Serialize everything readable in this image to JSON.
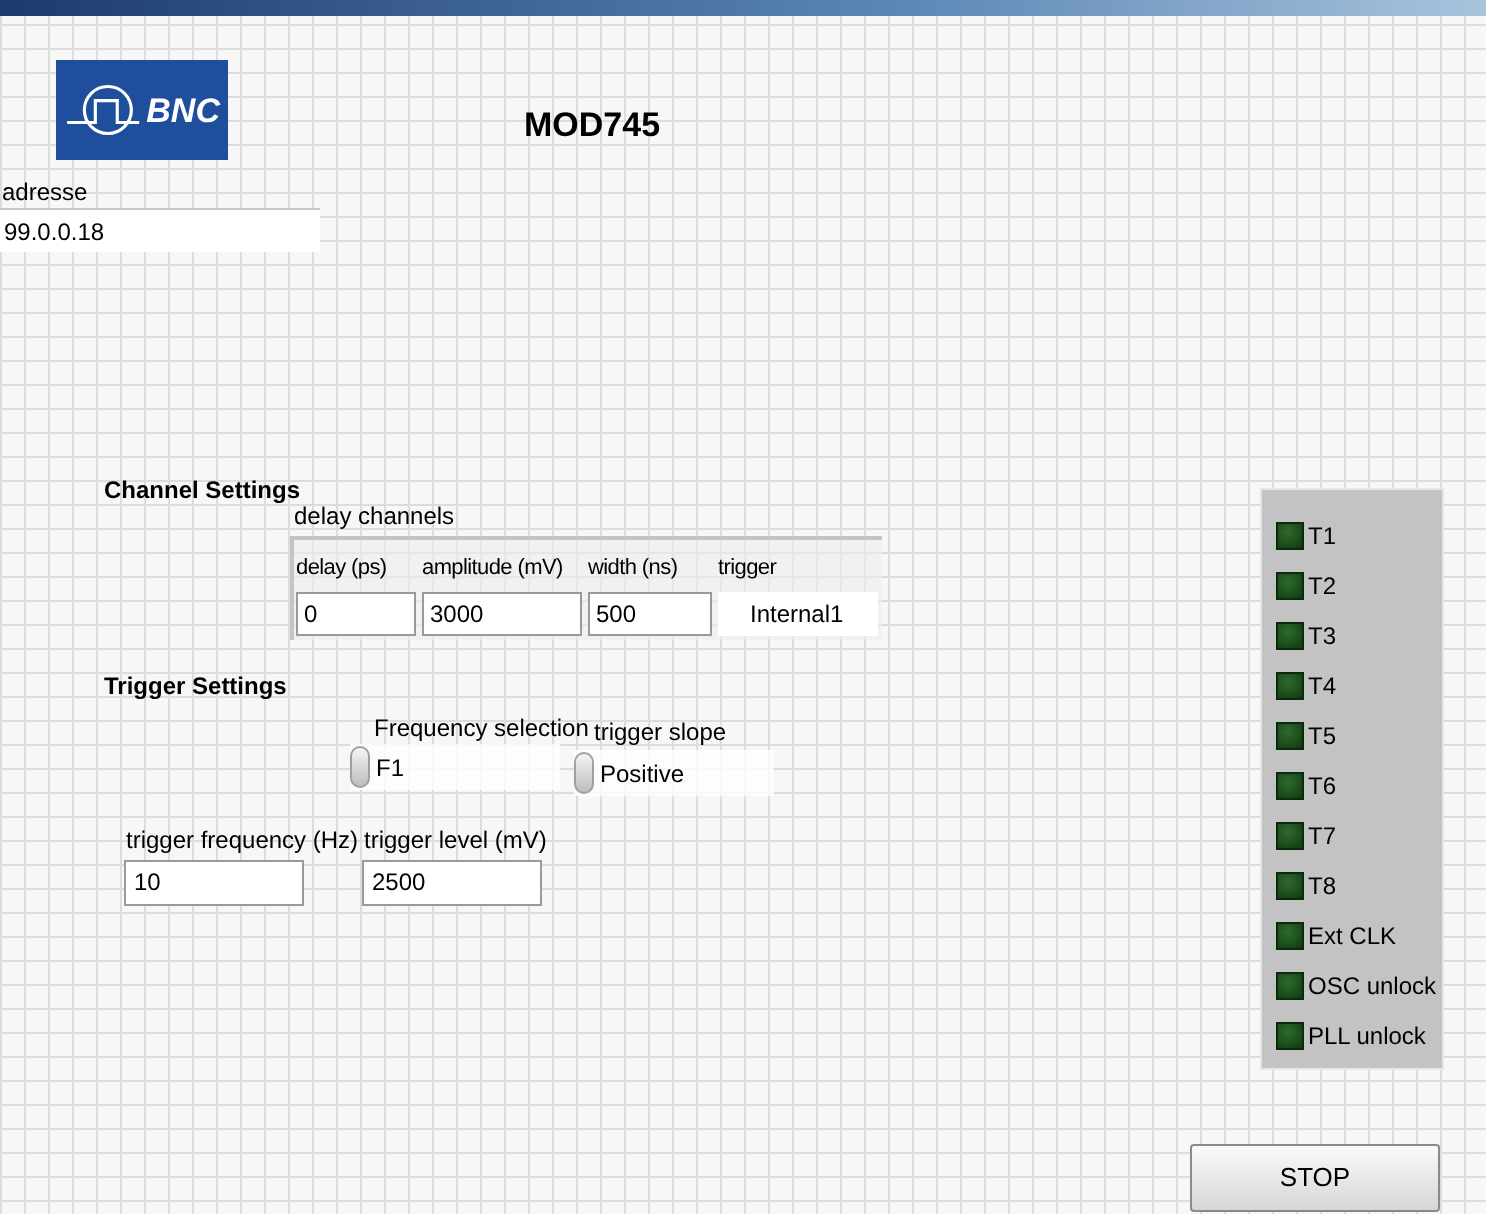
{
  "logo": {
    "text": "BNC"
  },
  "title": "MOD745",
  "address": {
    "label": "adresse",
    "value": "99.0.0.18"
  },
  "channel_settings": {
    "label": "Channel Settings",
    "table": {
      "label": "delay channels",
      "columns": [
        {
          "label": "delay (ps)",
          "value": "0",
          "kind": "numeric"
        },
        {
          "label": "amplitude (mV)",
          "value": "3000",
          "kind": "numeric"
        },
        {
          "label": "width (ns)",
          "value": "500",
          "kind": "numeric"
        },
        {
          "label": "trigger",
          "value": "Internal1",
          "kind": "ring"
        }
      ]
    }
  },
  "trigger_settings": {
    "label": "Trigger Settings",
    "frequency_selection": {
      "label": "Frequency selection",
      "value": "F1"
    },
    "trigger_slope": {
      "label": "trigger slope",
      "value": "Positive"
    },
    "trigger_frequency": {
      "label": "trigger frequency (Hz)",
      "value": "10"
    },
    "trigger_level": {
      "label": "trigger level (mV)",
      "value": "2500"
    }
  },
  "indicators": [
    {
      "label": "T1",
      "on": false
    },
    {
      "label": "T2",
      "on": false
    },
    {
      "label": "T3",
      "on": false
    },
    {
      "label": "T4",
      "on": false
    },
    {
      "label": "T5",
      "on": false
    },
    {
      "label": "T6",
      "on": false
    },
    {
      "label": "T7",
      "on": false
    },
    {
      "label": "T8",
      "on": false
    },
    {
      "label": "Ext CLK",
      "on": false
    },
    {
      "label": "OSC unlock",
      "on": false
    },
    {
      "label": "PLL unlock",
      "on": false
    }
  ],
  "stop_button": {
    "label": "STOP"
  }
}
